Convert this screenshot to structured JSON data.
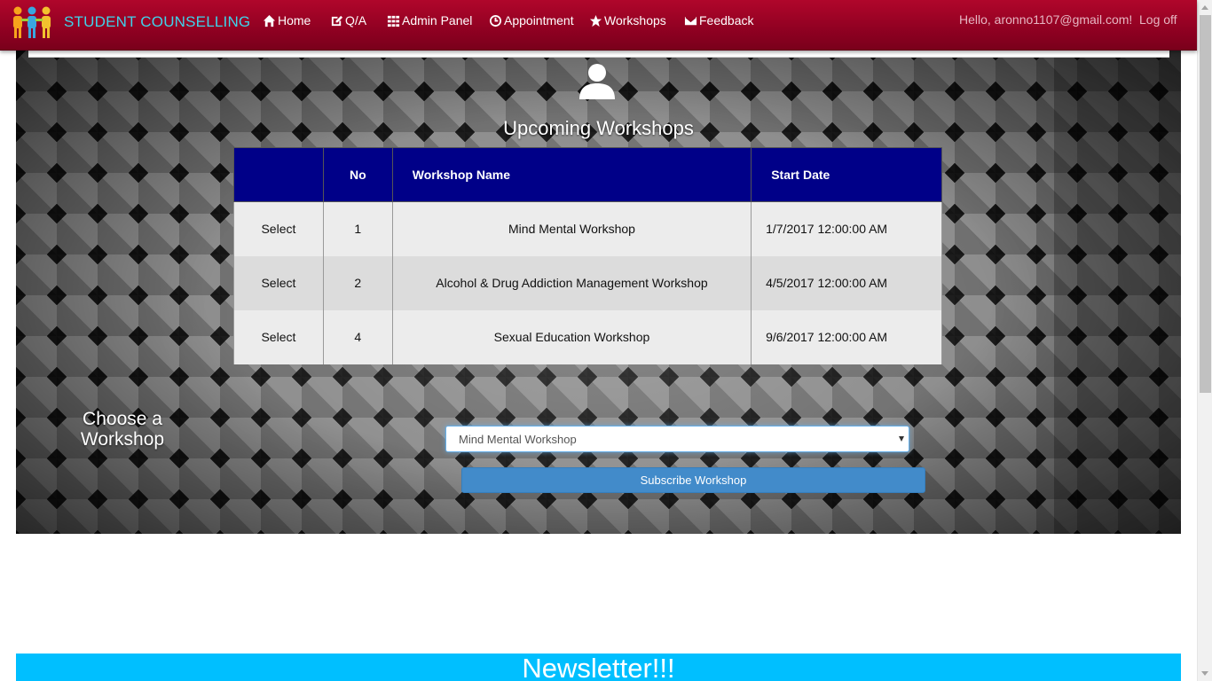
{
  "brand": {
    "title": "STUDENT COUNSELLING",
    "logo_icon": "people-group-icon"
  },
  "nav": {
    "items": [
      {
        "label": "Home",
        "icon": "home-icon"
      },
      {
        "label": "Q/A",
        "icon": "edit-icon"
      },
      {
        "label": "Admin Panel",
        "icon": "grid-icon"
      },
      {
        "label": "Appointment",
        "icon": "clock-icon"
      },
      {
        "label": "Workshops",
        "icon": "star-icon"
      },
      {
        "label": "Feedback",
        "icon": "envelope-icon"
      }
    ],
    "greeting": "Hello, aronno1107@gmail.com!",
    "logoff": "Log off"
  },
  "hero": {
    "icon": "user-icon",
    "title": "Upcoming Workshops"
  },
  "table": {
    "headers": [
      "",
      "No",
      "Workshop Name",
      "Start Date"
    ],
    "rows": [
      {
        "action": "Select",
        "no": "1",
        "name": "Mind Mental Workshop",
        "date": "1/7/2017 12:00:00 AM"
      },
      {
        "action": "Select",
        "no": "2",
        "name": "Alcohol & Drug Addiction Management Workshop",
        "date": "4/5/2017 12:00:00 AM"
      },
      {
        "action": "Select",
        "no": "4",
        "name": "Sexual Education Workshop",
        "date": "9/6/2017 12:00:00 AM"
      }
    ]
  },
  "form": {
    "choose_label": "Choose a Workshop",
    "selected": "Mind Mental Workshop",
    "subscribe_label": "Subscribe Workshop"
  },
  "newsletter": {
    "title": "Newsletter!!!"
  },
  "colors": {
    "navbar": "#9b0326",
    "brand_text": "#3fd3ea",
    "table_header": "#000088",
    "button": "#428bca",
    "newsletter": "#00bfff"
  }
}
